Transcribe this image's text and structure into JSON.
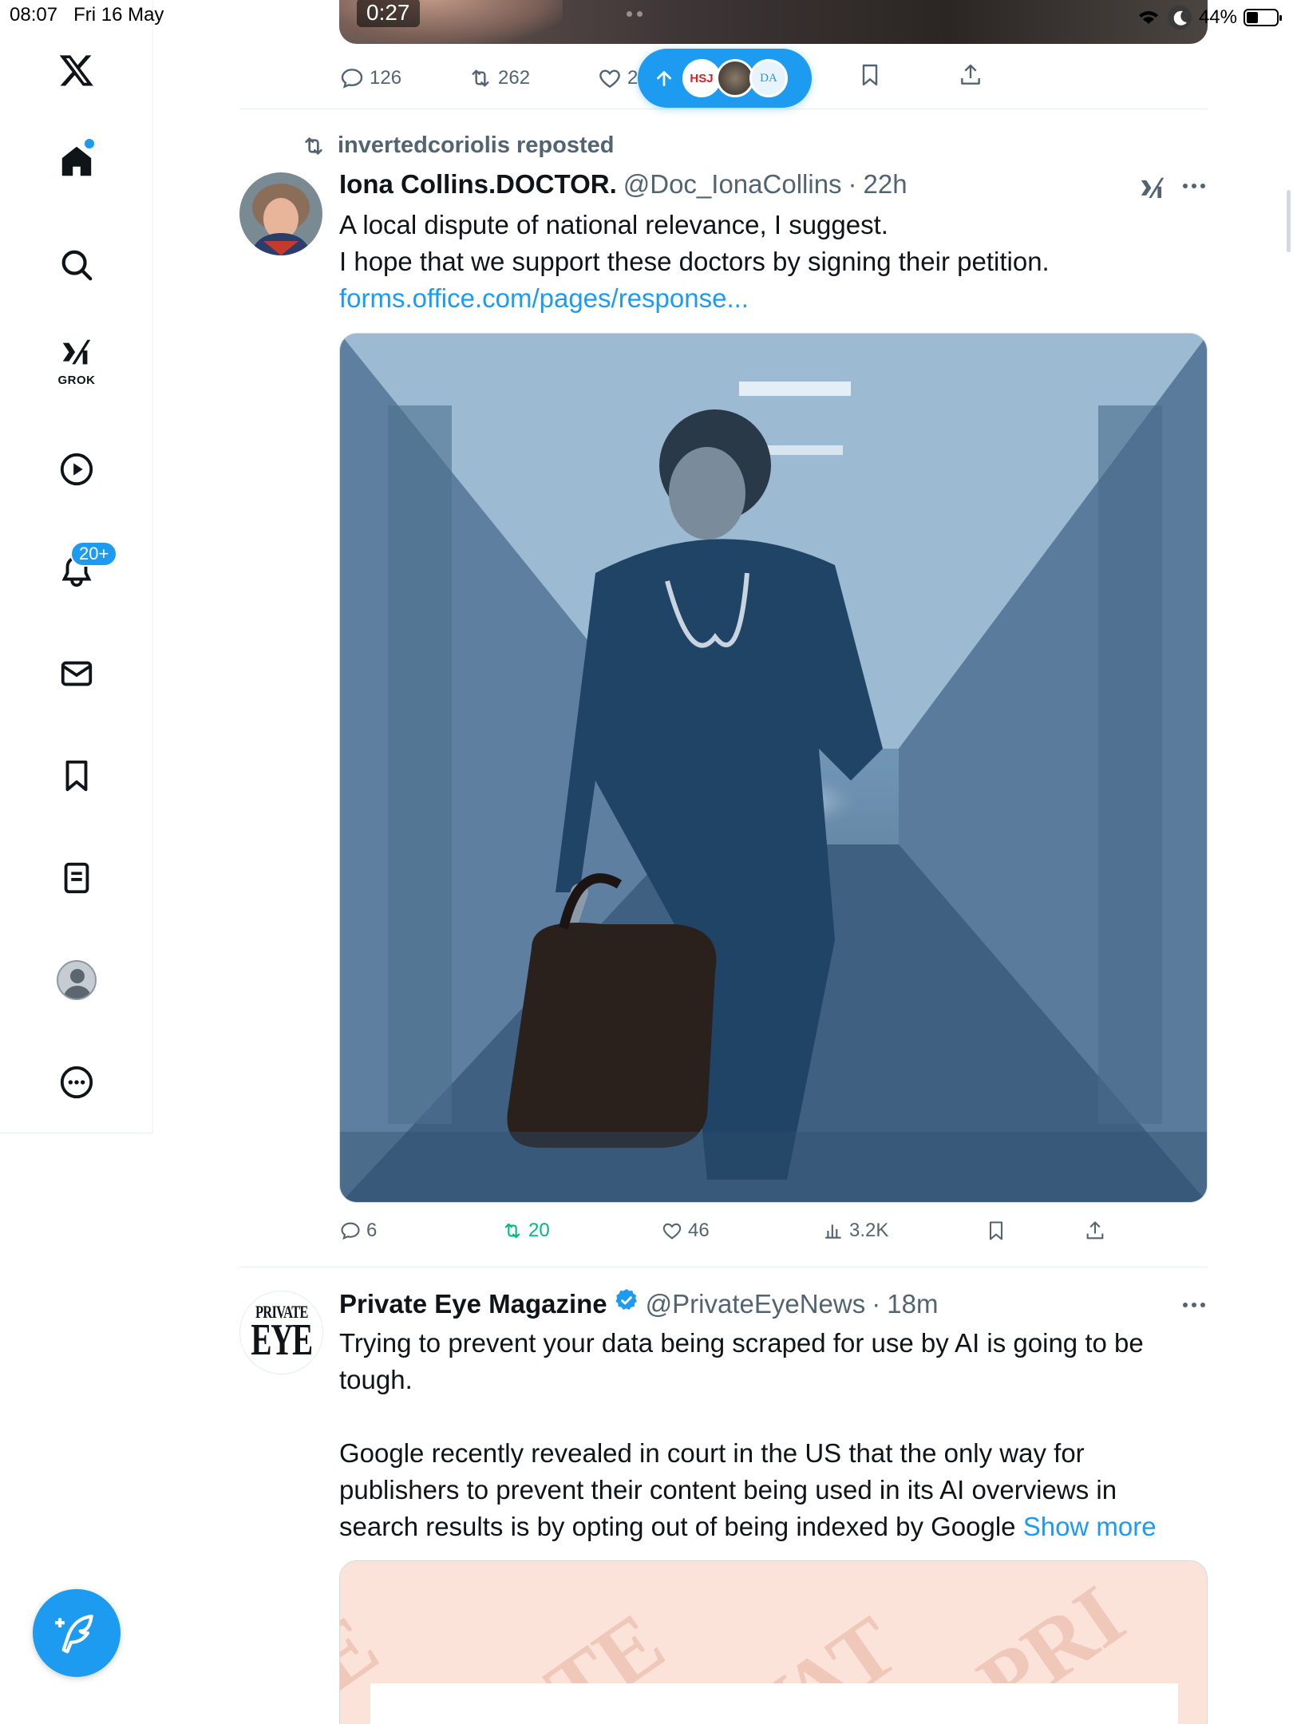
{
  "status_bar": {
    "time": "08:07",
    "date": "Fri 16 May",
    "battery": "44%"
  },
  "sidebar": {
    "grok_label": "GROK",
    "notifications_badge": "20+"
  },
  "top_post": {
    "video_time": "0:27",
    "replies": "126",
    "reposts": "262",
    "likes": "2"
  },
  "new_posts_pill": {
    "avatars": [
      "HSJ",
      "",
      "DA"
    ]
  },
  "tweet1": {
    "repost_by": "invertedcoriolis reposted",
    "name": "Iona Collins.DOCTOR.",
    "handle": "@Doc_IonaCollins",
    "sep": "·",
    "time": "22h",
    "text_line1": "A local dispute of national relevance, I suggest.",
    "text_line2": "I hope that we support these doctors by signing their petition.",
    "link": "forms.office.com/pages/response...",
    "replies": "6",
    "reposts": "20",
    "likes": "46",
    "views": "3.2K"
  },
  "tweet2": {
    "avatar_small": "PRIVATE",
    "avatar_big": "EYE",
    "name": "Private Eye Magazine",
    "handle": "@PrivateEyeNews",
    "sep": "·",
    "time": "18m",
    "para1": "Trying to prevent your data being scraped for use by AI is going to be tough.",
    "para2": "Google recently revealed in court in the US that the only way for publishers to prevent their content being used in its AI overviews in search results is by opting out of being indexed by Google",
    "show_more": "Show more"
  },
  "colors": {
    "accent": "#1d9bf0",
    "repost_green": "#00ba7c",
    "muted": "#536471"
  }
}
